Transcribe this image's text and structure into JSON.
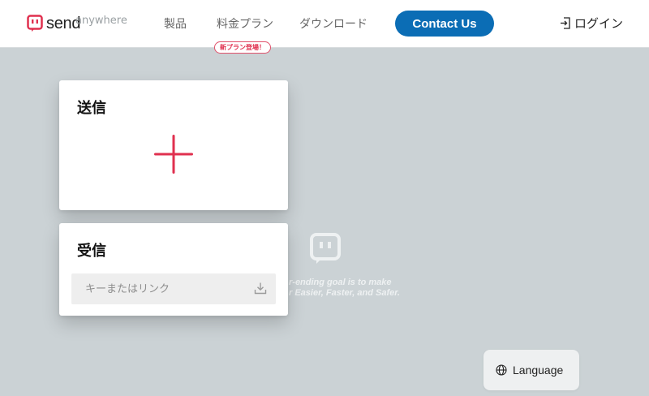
{
  "header": {
    "logo_text": "send",
    "logo_overlap_text": "anywhere",
    "nav": [
      {
        "label": "製品"
      },
      {
        "label": "料金プラン"
      },
      {
        "label": "ダウンロード"
      }
    ],
    "plan_badge": "新プラン登場！",
    "contact_label": "Contact Us",
    "login_label": "ログイン"
  },
  "send_card": {
    "title": "送信",
    "add_icon": "plus-icon"
  },
  "receive_card": {
    "title": "受信",
    "input_placeholder": "キーまたはリンク",
    "input_value": "",
    "download_icon": "download-icon"
  },
  "background": {
    "tagline_line1": "r-ending goal is to make",
    "tagline_line2": "r Easier, Faster, and Safer."
  },
  "language_button": {
    "label": "Language",
    "icon": "globe-icon"
  },
  "colors": {
    "brand_red": "#e0304f",
    "brand_blue": "#0b6db5",
    "background": "#cbd2d5"
  }
}
